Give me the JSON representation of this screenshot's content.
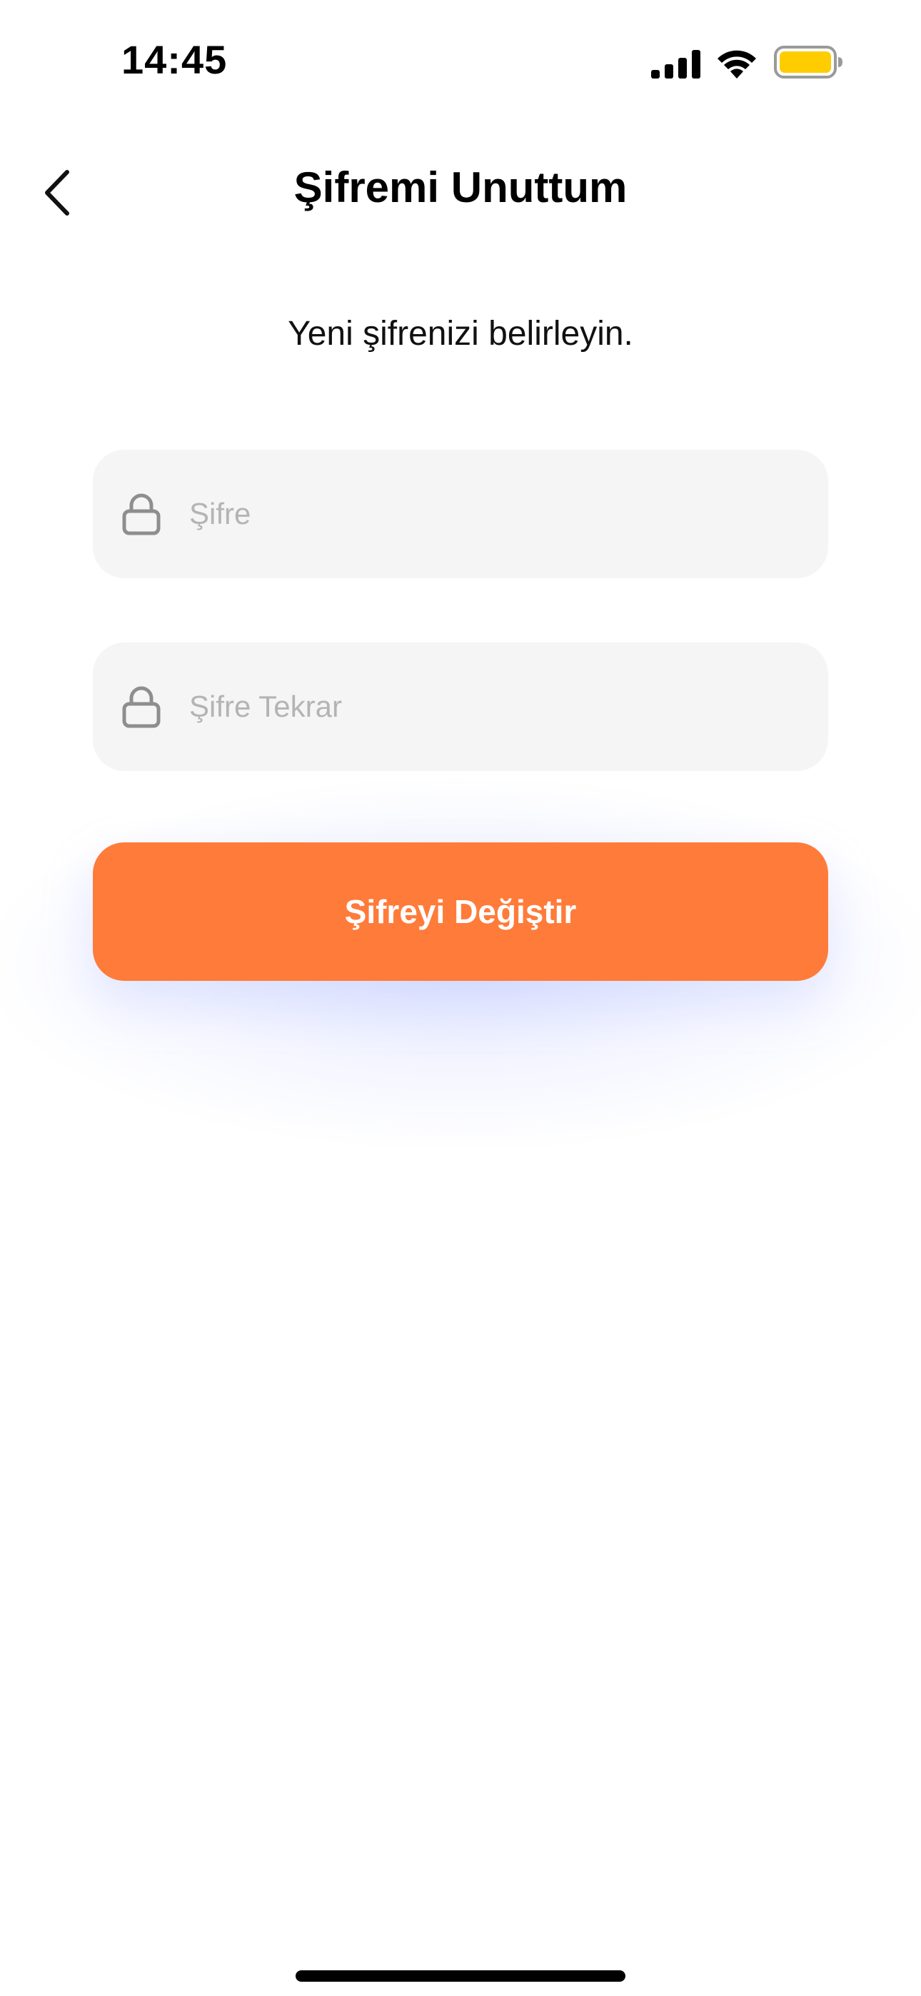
{
  "status_bar": {
    "time": "14:45",
    "icons": [
      "signal-icon",
      "wifi-icon",
      "battery-icon"
    ],
    "battery_color": "#ffcc00"
  },
  "header": {
    "title": "Şifremi Unuttum",
    "back_icon": "chevron-left-icon"
  },
  "main": {
    "subtitle": "Yeni şifrenizi belirleyin.",
    "password_field": {
      "placeholder": "Şifre",
      "value": "",
      "icon": "lock-icon"
    },
    "password_repeat_field": {
      "placeholder": "Şifre Tekrar",
      "value": "",
      "icon": "lock-icon"
    },
    "submit_button": {
      "label": "Şifreyi Değiştir",
      "color": "#ff7b3a"
    }
  }
}
